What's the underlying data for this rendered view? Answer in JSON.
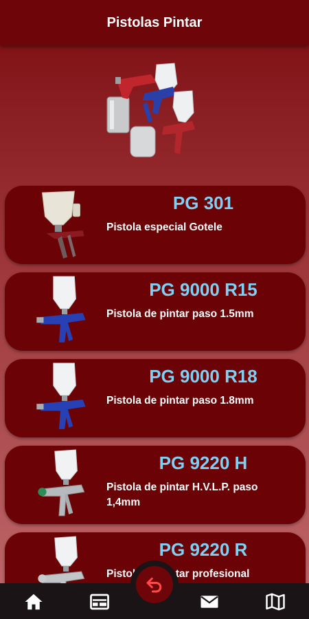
{
  "header": {
    "title": "Pistolas Pintar"
  },
  "products": [
    {
      "code": "PG 301",
      "description": "Pistola especial Gotele"
    },
    {
      "code": "PG 9000 R15",
      "description": "Pistola de pintar paso 1.5mm"
    },
    {
      "code": "PG 9000 R18",
      "description": "Pistola de pintar paso 1.8mm"
    },
    {
      "code": "PG 9220 H",
      "description": "Pistola de pintar H.V.L.P. paso 1,4mm"
    },
    {
      "code": "PG 9220 R",
      "description": "Pistola de pintar profesional"
    }
  ],
  "bottom_nav": {
    "items": [
      {
        "icon": "home-icon"
      },
      {
        "icon": "catalog-icon"
      },
      {
        "icon": "mail-icon"
      },
      {
        "icon": "map-icon"
      }
    ],
    "fab_icon": "back-arrow-icon"
  },
  "colors": {
    "accent": "#7fd0f2",
    "card": "#6b0206",
    "header": "#6e0508"
  }
}
